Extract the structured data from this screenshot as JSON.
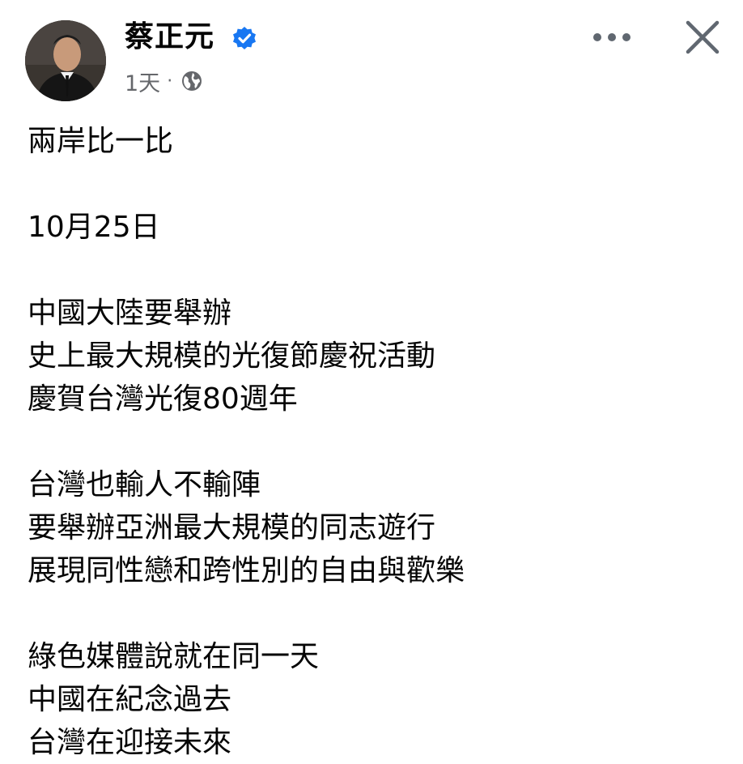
{
  "post": {
    "author": {
      "name": "蔡正元",
      "verified": true
    },
    "meta": {
      "time": "1天",
      "separator": "·",
      "audience_icon": "globe-icon"
    },
    "actions": {
      "more_icon": "more-horizontal-icon",
      "close_icon": "close-icon"
    },
    "paragraphs": [
      [
        "兩岸比一比"
      ],
      [
        "10月25日"
      ],
      [
        "中國大陸要舉辦",
        "史上最大規模的光復節慶祝活動",
        "慶賀台灣光復80週年"
      ],
      [
        "台灣也輸人不輸陣",
        "要舉辦亞洲最大規模的同志遊行",
        "展現同性戀和跨性別的自由與歡樂"
      ],
      [
        "綠色媒體說就在同一天",
        "中國在紀念過去",
        "台灣在迎接未來"
      ]
    ]
  },
  "colors": {
    "text": "#050505",
    "secondary": "#65676b",
    "verified": "#1877f2",
    "icon": "#606770"
  }
}
